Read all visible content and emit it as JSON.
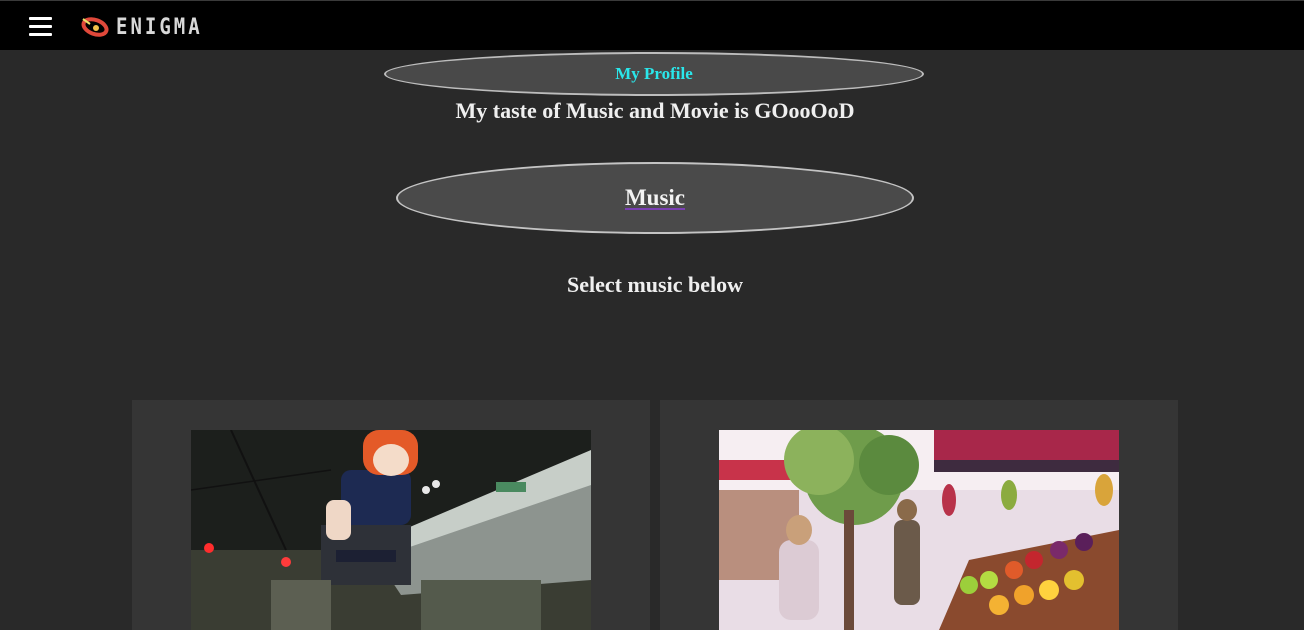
{
  "app": {
    "brand": "ENIGMA",
    "menu_icon": "hamburger-menu-icon",
    "logo_icon": "eye-logo-icon"
  },
  "profile": {
    "button_label": "My Profile",
    "tagline": "My taste of Music and Movie is GOooOoD"
  },
  "section": {
    "music_label": "Music",
    "select_prompt": "Select music below"
  },
  "music_cards": [
    {
      "thumbnail": "anime-girl-city-night-thumbnail"
    },
    {
      "thumbnail": "anime-fruit-market-thumbnail"
    }
  ],
  "colors": {
    "background": "#292929",
    "topbar": "#000000",
    "pill": "#494949",
    "profile_text": "#2ae6ea",
    "card": "#353535"
  }
}
